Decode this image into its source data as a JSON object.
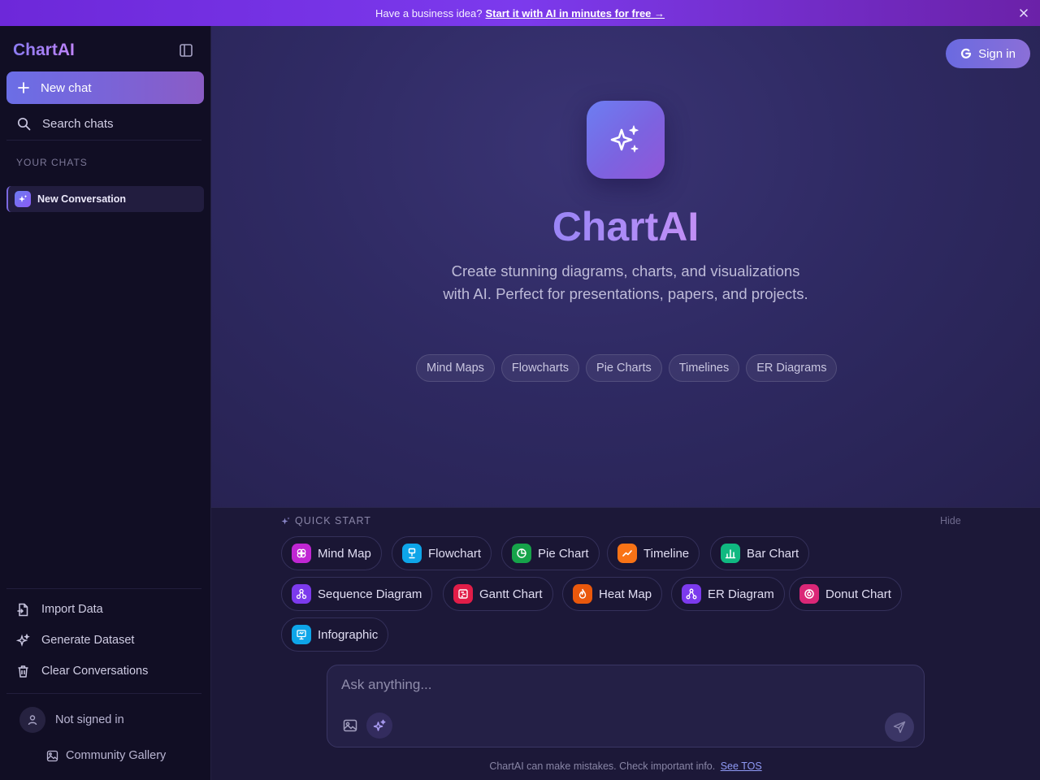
{
  "banner": {
    "text": "Have a business idea?",
    "link": "Start it with AI in minutes for free →",
    "close_icon": "x-icon"
  },
  "sidebar": {
    "brand": "ChartAI",
    "new_chat": "New chat",
    "search": "Search chats",
    "section_title": "YOUR CHATS",
    "chats": [
      {
        "label": "New Conversation"
      }
    ],
    "actions": {
      "import": "Import Data",
      "generate": "Generate Dataset",
      "clear": "Clear Conversations"
    },
    "user_status": "Not signed in",
    "gallery": "Community Gallery"
  },
  "header": {
    "signin": "Sign in"
  },
  "hero": {
    "title": "ChartAI",
    "subtitle": "Create stunning diagrams, charts, and visualizations with AI. Perfect for presentations, papers, and projects.",
    "pills": [
      "Mind Maps",
      "Flowcharts",
      "Pie Charts",
      "Timelines",
      "ER Diagrams"
    ]
  },
  "quick_start": {
    "label": "QUICK START",
    "hide": "Hide",
    "chips": [
      {
        "label": "Mind Map",
        "color": "#c026d3",
        "icon": "brain-icon"
      },
      {
        "label": "Flowchart",
        "color": "#0ea5e9",
        "icon": "flowchart-icon"
      },
      {
        "label": "Pie Chart",
        "color": "#16a34a",
        "icon": "pie-chart-icon"
      },
      {
        "label": "Timeline",
        "color": "#f97316",
        "icon": "timeline-icon"
      },
      {
        "label": "Bar Chart",
        "color": "#10b981",
        "icon": "bar-chart-icon"
      },
      {
        "label": "Sequence Diagram",
        "color": "#7c3aed",
        "icon": "sequence-icon"
      },
      {
        "label": "Gantt Chart",
        "color": "#e11d48",
        "icon": "gantt-icon"
      },
      {
        "label": "Heat Map",
        "color": "#ea580c",
        "icon": "flame-icon"
      },
      {
        "label": "ER Diagram",
        "color": "#7c3aed",
        "icon": "er-diagram-icon"
      },
      {
        "label": "Donut Chart",
        "color": "#db2777",
        "icon": "donut-chart-icon"
      },
      {
        "label": "Infographic",
        "color": "#0ea5e9",
        "icon": "presentation-icon"
      }
    ]
  },
  "composer": {
    "placeholder": "Ask anything..."
  },
  "footer": {
    "disclaimer": "ChartAI can make mistakes. Check important info.",
    "tos": "See TOS"
  }
}
